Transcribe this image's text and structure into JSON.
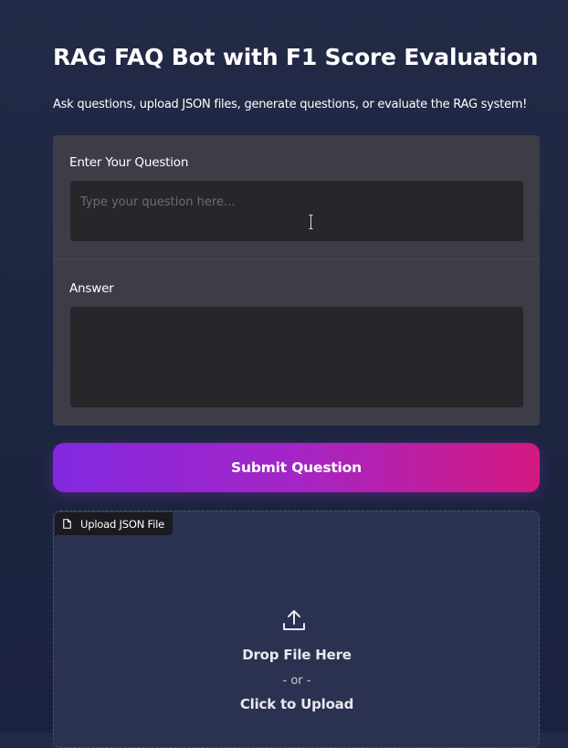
{
  "header": {
    "title": "RAG FAQ Bot with F1 Score Evaluation",
    "subtitle": "Ask questions, upload JSON files, generate questions, or evaluate the RAG system!"
  },
  "question_panel": {
    "question_label": "Enter Your Question",
    "question_placeholder": "Type your question here...",
    "question_value": "",
    "answer_label": "Answer",
    "answer_value": ""
  },
  "submit": {
    "label": "Submit Question"
  },
  "upload": {
    "tag_label": "Upload JSON File",
    "drop_text": "Drop File Here",
    "or_text": "- or -",
    "click_text": "Click to Upload",
    "icons": {
      "tag": "file-icon",
      "main": "upload-icon"
    }
  },
  "colors": {
    "accent_start": "#8228e0",
    "accent_end": "#d41980",
    "panel": "#3d3d47",
    "input": "#26262b"
  }
}
